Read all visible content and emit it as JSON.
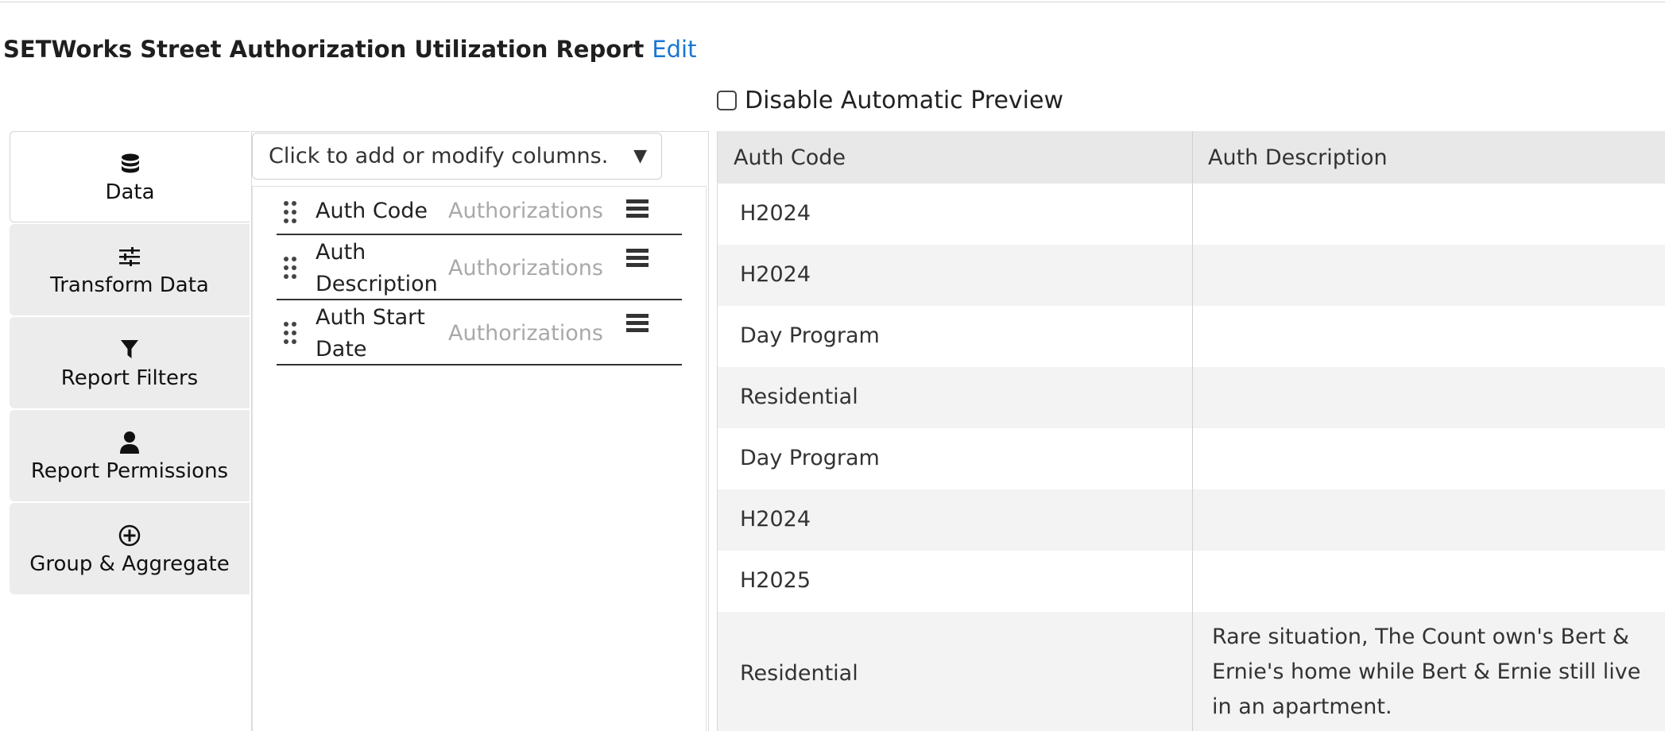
{
  "header": {
    "title": "SETWorks Street Authorization Utilization Report",
    "edit_label": "Edit"
  },
  "preview": {
    "disable_label": "Disable Automatic Preview",
    "disabled": false
  },
  "tabs": [
    {
      "label": "Data",
      "icon": "database-icon",
      "active": true
    },
    {
      "label": "Transform Data",
      "icon": "sliders-icon",
      "active": false
    },
    {
      "label": "Report Filters",
      "icon": "filter-icon",
      "active": false
    },
    {
      "label": "Report Permissions",
      "icon": "person-icon",
      "active": false
    },
    {
      "label": "Group & Aggregate",
      "icon": "plus-circle-icon",
      "active": false
    }
  ],
  "columns_picker": {
    "placeholder": "Click to add or modify columns.",
    "arrow": "▼"
  },
  "columns": [
    {
      "name": "Auth Code",
      "table": "Authorizations"
    },
    {
      "name": "Auth Description",
      "table": "Authorizations"
    },
    {
      "name": "Auth Start Date",
      "table": "Authorizations"
    }
  ],
  "table": {
    "headers": [
      "Auth Code",
      "Auth Description"
    ],
    "rows": [
      {
        "code": "H2024",
        "description": ""
      },
      {
        "code": "H2024",
        "description": ""
      },
      {
        "code": "Day Program",
        "description": ""
      },
      {
        "code": "Residential",
        "description": ""
      },
      {
        "code": "Day Program",
        "description": ""
      },
      {
        "code": "H2024",
        "description": ""
      },
      {
        "code": "H2025",
        "description": ""
      },
      {
        "code": "Residential",
        "description": "Rare situation, The Count own's Bert & Ernie's home while Bert & Ernie still live in an apartment."
      }
    ]
  }
}
